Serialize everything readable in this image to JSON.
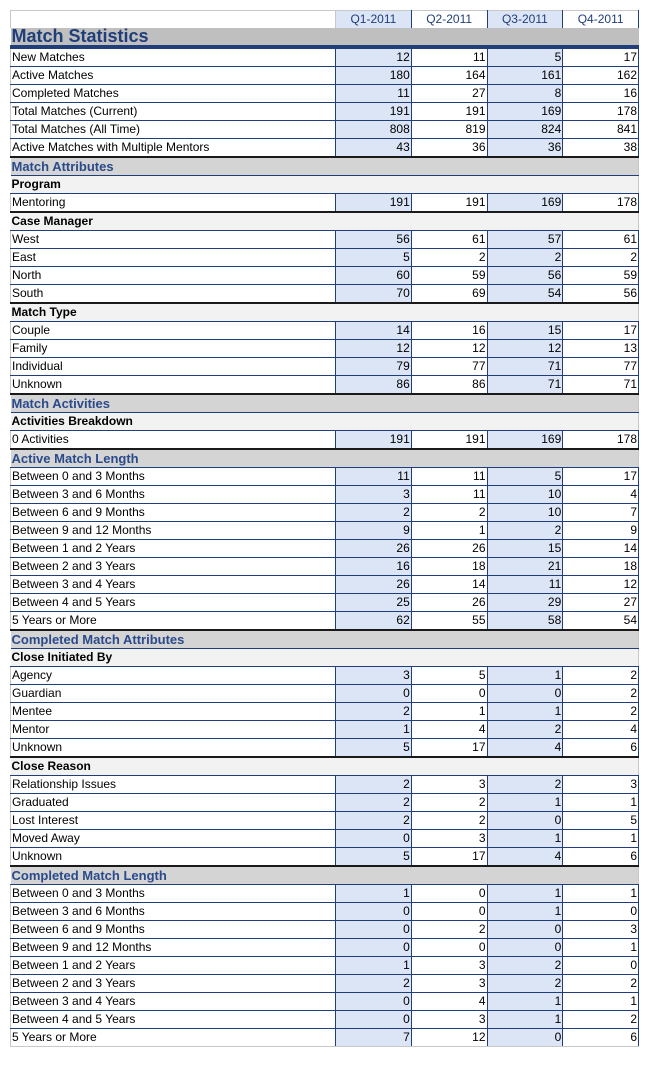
{
  "columns": [
    "Q1-2011",
    "Q2-2011",
    "Q3-2011",
    "Q4-2011"
  ],
  "title": "Match Statistics",
  "blocks": [
    {
      "type": "data",
      "rows": [
        {
          "label": "New Matches",
          "values": [
            12,
            11,
            5,
            17
          ]
        },
        {
          "label": "Active Matches",
          "values": [
            180,
            164,
            161,
            162
          ]
        },
        {
          "label": "Completed Matches",
          "values": [
            11,
            27,
            8,
            16
          ]
        },
        {
          "label": "Total Matches (Current)",
          "values": [
            191,
            191,
            169,
            178
          ]
        },
        {
          "label": "Total Matches (All Time)",
          "values": [
            808,
            819,
            824,
            841
          ]
        },
        {
          "label": "Active Matches with Multiple Mentors",
          "values": [
            43,
            36,
            36,
            38
          ]
        }
      ]
    },
    {
      "type": "section",
      "label": "Match Attributes"
    },
    {
      "type": "subhead",
      "label": "Program"
    },
    {
      "type": "data",
      "rows": [
        {
          "label": "Mentoring",
          "values": [
            191,
            191,
            169,
            178
          ]
        }
      ]
    },
    {
      "type": "subhead",
      "label": "Case Manager"
    },
    {
      "type": "data",
      "rows": [
        {
          "label": "West",
          "values": [
            56,
            61,
            57,
            61
          ]
        },
        {
          "label": "East",
          "values": [
            5,
            2,
            2,
            2
          ]
        },
        {
          "label": "North",
          "values": [
            60,
            59,
            56,
            59
          ]
        },
        {
          "label": "South",
          "values": [
            70,
            69,
            54,
            56
          ]
        }
      ]
    },
    {
      "type": "subhead",
      "label": "Match Type"
    },
    {
      "type": "data",
      "rows": [
        {
          "label": "Couple",
          "values": [
            14,
            16,
            15,
            17
          ]
        },
        {
          "label": "Family",
          "values": [
            12,
            12,
            12,
            13
          ]
        },
        {
          "label": "Individual",
          "values": [
            79,
            77,
            71,
            77
          ]
        },
        {
          "label": "Unknown",
          "values": [
            86,
            86,
            71,
            71
          ]
        }
      ]
    },
    {
      "type": "section",
      "label": "Match Activities"
    },
    {
      "type": "subhead",
      "label": "Activities Breakdown"
    },
    {
      "type": "data",
      "rows": [
        {
          "label": "0 Activities",
          "values": [
            191,
            191,
            169,
            178
          ]
        }
      ]
    },
    {
      "type": "section",
      "label": "Active Match Length"
    },
    {
      "type": "data",
      "rows": [
        {
          "label": "Between 0 and 3 Months",
          "values": [
            11,
            11,
            5,
            17
          ]
        },
        {
          "label": "Between 3 and 6 Months",
          "values": [
            3,
            11,
            10,
            4
          ]
        },
        {
          "label": "Between 6 and 9 Months",
          "values": [
            2,
            2,
            10,
            7
          ]
        },
        {
          "label": "Between 9 and 12 Months",
          "values": [
            9,
            1,
            2,
            9
          ]
        },
        {
          "label": "Between 1 and 2 Years",
          "values": [
            26,
            26,
            15,
            14
          ]
        },
        {
          "label": "Between 2 and 3 Years",
          "values": [
            16,
            18,
            21,
            18
          ]
        },
        {
          "label": "Between 3 and 4 Years",
          "values": [
            26,
            14,
            11,
            12
          ]
        },
        {
          "label": "Between 4 and 5 Years",
          "values": [
            25,
            26,
            29,
            27
          ]
        },
        {
          "label": "5 Years or More",
          "values": [
            62,
            55,
            58,
            54
          ]
        }
      ]
    },
    {
      "type": "section",
      "label": "Completed Match Attributes"
    },
    {
      "type": "subhead",
      "label": "Close Initiated By"
    },
    {
      "type": "data",
      "rows": [
        {
          "label": "Agency",
          "values": [
            3,
            5,
            1,
            2
          ]
        },
        {
          "label": "Guardian",
          "values": [
            0,
            0,
            0,
            2
          ]
        },
        {
          "label": "Mentee",
          "values": [
            2,
            1,
            1,
            2
          ]
        },
        {
          "label": "Mentor",
          "values": [
            1,
            4,
            2,
            4
          ]
        },
        {
          "label": "Unknown",
          "values": [
            5,
            17,
            4,
            6
          ]
        }
      ]
    },
    {
      "type": "subhead",
      "label": "Close Reason"
    },
    {
      "type": "data",
      "rows": [
        {
          "label": "Relationship Issues",
          "values": [
            2,
            3,
            2,
            3
          ]
        },
        {
          "label": "Graduated",
          "values": [
            2,
            2,
            1,
            1
          ]
        },
        {
          "label": "Lost Interest",
          "values": [
            2,
            2,
            0,
            5
          ]
        },
        {
          "label": "Moved Away",
          "values": [
            0,
            3,
            1,
            1
          ]
        },
        {
          "label": "Unknown",
          "values": [
            5,
            17,
            4,
            6
          ]
        }
      ]
    },
    {
      "type": "section",
      "label": "Completed Match Length"
    },
    {
      "type": "data",
      "final": true,
      "rows": [
        {
          "label": "Between 0 and 3 Months",
          "values": [
            1,
            0,
            1,
            1
          ]
        },
        {
          "label": "Between 3 and 6 Months",
          "values": [
            0,
            0,
            1,
            0
          ]
        },
        {
          "label": "Between 6 and 9 Months",
          "values": [
            0,
            2,
            0,
            3
          ]
        },
        {
          "label": "Between 9 and 12 Months",
          "values": [
            0,
            0,
            0,
            1
          ]
        },
        {
          "label": "Between 1 and 2 Years",
          "values": [
            1,
            3,
            2,
            0
          ]
        },
        {
          "label": "Between 2 and 3 Years",
          "values": [
            2,
            3,
            2,
            2
          ]
        },
        {
          "label": "Between 3 and 4 Years",
          "values": [
            0,
            4,
            1,
            1
          ]
        },
        {
          "label": "Between 4 and 5 Years",
          "values": [
            0,
            3,
            1,
            2
          ]
        },
        {
          "label": "5 Years or More",
          "values": [
            7,
            12,
            0,
            6
          ]
        }
      ]
    }
  ]
}
